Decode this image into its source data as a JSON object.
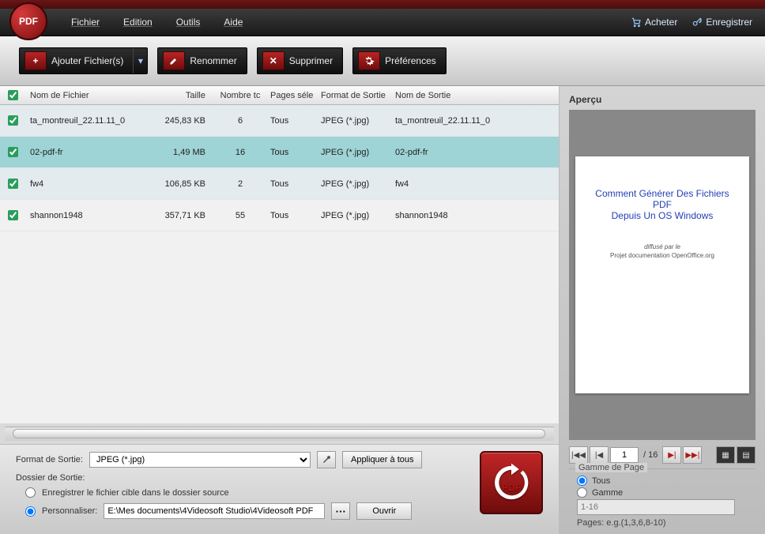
{
  "logo_text": "PDF",
  "menu": {
    "file": "Fichier",
    "edit": "Edition",
    "tools": "Outils",
    "help": "Aide"
  },
  "top_links": {
    "buy": "Acheter",
    "register": "Enregistrer"
  },
  "toolbar": {
    "add": "Ajouter Fichier(s)",
    "rename": "Renommer",
    "delete": "Supprimer",
    "prefs": "Préférences"
  },
  "table": {
    "headers": {
      "filename": "Nom de Fichier",
      "size": "Taille",
      "pagecount": "Nombre tc",
      "pagesel": "Pages séle",
      "format": "Format de Sortie",
      "outname": "Nom de Sortie"
    },
    "rows": [
      {
        "name": "ta_montreuil_22.11.11_0",
        "size": "245,83 KB",
        "pages": "6",
        "sel": "Tous",
        "fmt": "JPEG (*.jpg)",
        "out": "ta_montreuil_22.11.11_0"
      },
      {
        "name": "02-pdf-fr",
        "size": "1,49 MB",
        "pages": "16",
        "sel": "Tous",
        "fmt": "JPEG (*.jpg)",
        "out": "02-pdf-fr"
      },
      {
        "name": "fw4",
        "size": "106,85 KB",
        "pages": "2",
        "sel": "Tous",
        "fmt": "JPEG (*.jpg)",
        "out": "fw4"
      },
      {
        "name": "shannon1948",
        "size": "357,71 KB",
        "pages": "55",
        "sel": "Tous",
        "fmt": "JPEG (*.jpg)",
        "out": "shannon1948"
      }
    ]
  },
  "bottom": {
    "format_label": "Format de Sortie:",
    "format_value": "JPEG (*.jpg)",
    "apply_all": "Appliquer à tous",
    "folder_label": "Dossier de Sortie:",
    "opt_source": "Enregistrer le fichier cible dans le dossier source",
    "opt_custom": "Personnaliser:",
    "custom_path": "E:\\Mes documents\\4Videosoft Studio\\4Videosoft PDF",
    "open": "Ouvrir"
  },
  "preview": {
    "title": "Aperçu",
    "page_title_1": "Comment Générer Des Fichiers",
    "page_title_2": "PDF",
    "page_title_3": "Depuis Un OS Windows",
    "sub1": "diffusé par le",
    "sub2": "Projet documentation OpenOffice.org",
    "current": "1",
    "total": "/ 16"
  },
  "gamme": {
    "heading": "Gamme  de Page",
    "all": "Tous",
    "range": "Gamme",
    "range_value": "1-16",
    "hint": "Pages: e.g.(1,3,6,8-10)"
  },
  "convert_label": "PDF"
}
